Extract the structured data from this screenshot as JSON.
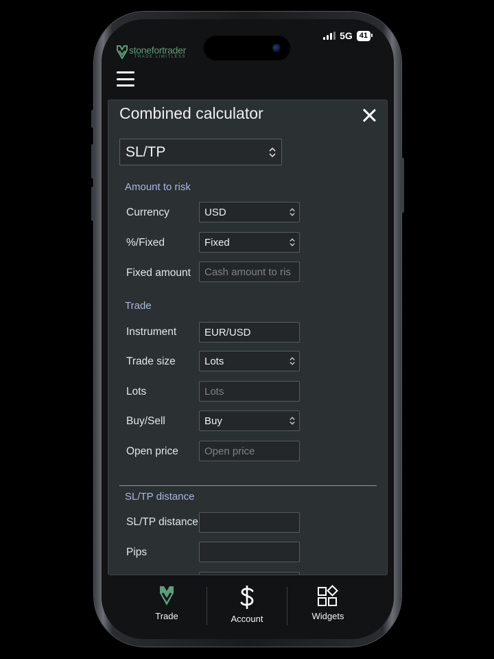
{
  "status": {
    "network": "5G",
    "battery": "41"
  },
  "brand": {
    "name": "stonefortrader",
    "tagline": "TRADE LIMITLESS"
  },
  "modal": {
    "title": "Combined calculator",
    "mode": "SL/TP",
    "sections": {
      "amount": {
        "heading": "Amount to risk",
        "currency_label": "Currency",
        "currency_value": "USD",
        "pct_label": "%/Fixed",
        "pct_value": "Fixed",
        "fixed_label": "Fixed amount",
        "fixed_placeholder": "Cash amount to ris"
      },
      "trade": {
        "heading": "Trade",
        "instrument_label": "Instrument",
        "instrument_value": "EUR/USD",
        "size_label": "Trade size",
        "size_value": "Lots",
        "lots_label": "Lots",
        "lots_placeholder": "Lots",
        "side_label": "Buy/Sell",
        "side_value": "Buy",
        "open_label": "Open price",
        "open_placeholder": "Open price"
      },
      "sltp": {
        "heading": "SL/TP distance",
        "distance_label": "SL/TP distance",
        "pips_label": "Pips"
      }
    }
  },
  "nav": {
    "trade": "Trade",
    "account": "Account",
    "widgets": "Widgets"
  },
  "colors": {
    "accent": "#5f9e7a",
    "section_heading": "#a9b9de",
    "modal_bg": "#2b3033"
  }
}
